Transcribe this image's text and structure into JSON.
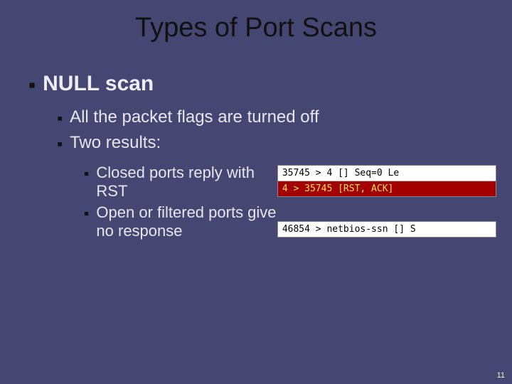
{
  "title": "Types of Port Scans",
  "bullets": {
    "l1": "NULL scan",
    "l2a": "All the packet flags are turned off",
    "l2b": "Two results:",
    "l3a": "Closed ports reply with RST",
    "l3b": "Open or filtered ports give no response"
  },
  "captures": {
    "top_req": "35745 > 4 [] Seq=0 Le",
    "top_rst": "4 > 35745 [RST, ACK]",
    "bottom": "46854 > netbios-ssn [] S"
  },
  "slide_number": "11"
}
